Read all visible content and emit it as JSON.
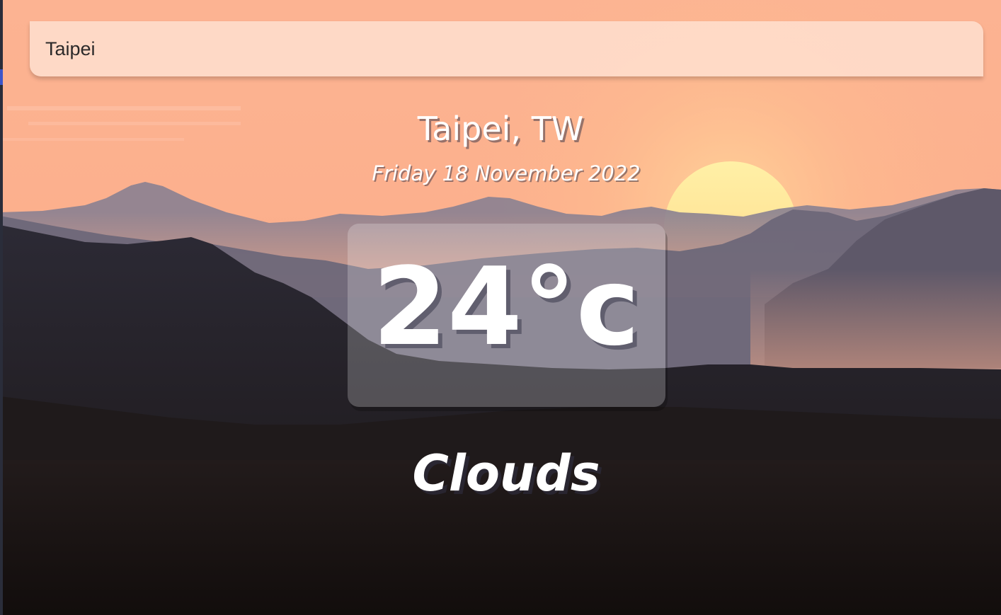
{
  "search": {
    "value": "Taipei"
  },
  "location": {
    "label": "Taipei, TW"
  },
  "date": {
    "label": "Friday 18 November 2022"
  },
  "weather": {
    "temperature": "24°c",
    "condition": "Clouds"
  },
  "theme": {
    "sky_top": "#fdb99b",
    "sky_horizon": "#ffc894",
    "sun": "#ffe9a0",
    "ground": "#14100f"
  }
}
